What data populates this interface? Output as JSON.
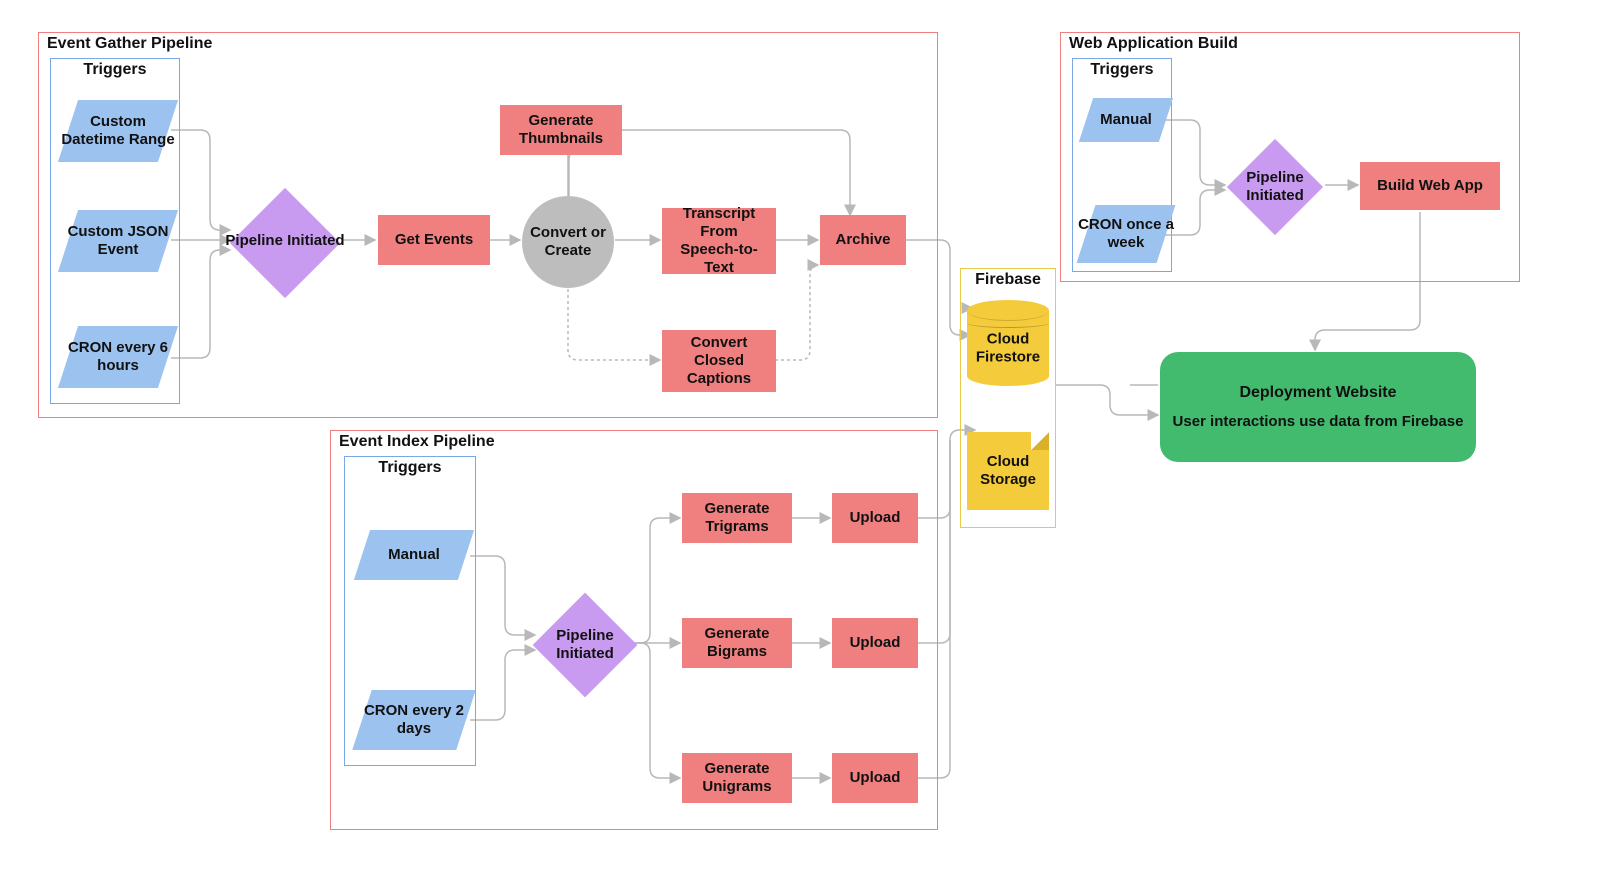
{
  "colors": {
    "containerBorder": "#f08080",
    "triggerBorder": "#7aa7e8",
    "firebaseBorder": "#e8c94a",
    "parallelogram": "#9cc2f0",
    "rhombus": "#c89af0",
    "process": "#f08080",
    "circle": "#bdbdbd",
    "database": "#f4cb3a",
    "deploy": "#42bb6f",
    "edge": "#b8b8b8"
  },
  "containers": {
    "gather": {
      "title": "Event Gather Pipeline"
    },
    "index": {
      "title": "Event Index Pipeline"
    },
    "web": {
      "title": "Web Application Build"
    },
    "firebase": {
      "title": "Firebase"
    }
  },
  "triggersTitle": "Triggers",
  "gather": {
    "triggers": [
      "Custom Datetime Range",
      "Custom JSON Event",
      "CRON every 6 hours"
    ],
    "pipelineInitiated": "Pipeline Initiated",
    "getEvents": "Get Events",
    "convertOrCreate": "Convert or Create",
    "generateThumbs": "Generate Thumbnails",
    "transcript": "Transcript From Speech-to-Text",
    "convertCC": "Convert Closed Captions",
    "archive": "Archive"
  },
  "index": {
    "triggers": [
      "Manual",
      "CRON every 2 days"
    ],
    "pipelineInitiated": "Pipeline Initiated",
    "genTri": "Generate Trigrams",
    "genBi": "Generate Bigrams",
    "genUni": "Generate Unigrams",
    "upload": "Upload"
  },
  "web": {
    "triggers": [
      "Manual",
      "CRON once a week"
    ],
    "pipelineInitiated": "Pipeline Initiated",
    "build": "Build Web App"
  },
  "firebase": {
    "firestore": "Cloud Firestore",
    "storage": "Cloud Storage"
  },
  "deploy": {
    "title": "Deployment Website",
    "sub": "User interactions use data from Firebase"
  }
}
